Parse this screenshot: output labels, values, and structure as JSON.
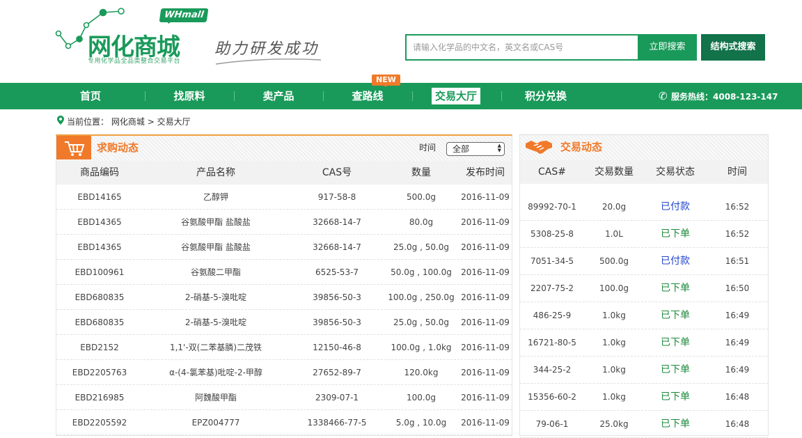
{
  "brand": {
    "logo_text": "网化商城",
    "logo_badge": "WHmall",
    "logo_sub": "专用化学品全品类整合交易平台",
    "slogan": "助力研发成功"
  },
  "search": {
    "placeholder": "请输入化学品的中文名，英文名或CAS号",
    "search_label": "立即搜索",
    "structure_label": "结构式搜索"
  },
  "nav": {
    "items": [
      "首页",
      "找原料",
      "卖产品",
      "查路线",
      "交易大厅",
      "积分兑换"
    ],
    "new_badge": "NEW",
    "hotline": "服务热线：4008-123-147"
  },
  "breadcrumb": {
    "prefix": "当前位置：",
    "home": "网化商城",
    "sep": ">",
    "current": "交易大厅"
  },
  "purchase": {
    "title": "求购动态",
    "time_label": "时间",
    "time_select": "全部",
    "headers": [
      "商品编码",
      "产品名称",
      "CAS号",
      "数量",
      "发布时间"
    ],
    "rows": [
      [
        "EBD14165",
        "乙醇钾",
        "917-58-8",
        "500.0g",
        "2016-11-09"
      ],
      [
        "EBD14365",
        "谷氨酸甲酯 盐酸盐",
        "32668-14-7",
        "80.0g",
        "2016-11-09"
      ],
      [
        "EBD14365",
        "谷氨酸甲酯 盐酸盐",
        "32668-14-7",
        "25.0g , 50.0g",
        "2016-11-09"
      ],
      [
        "EBD100961",
        "谷氨酸二甲酯",
        "6525-53-7",
        "50.0g , 100.0g",
        "2016-11-09"
      ],
      [
        "EBD680835",
        "2-硝基-5-溴吡啶",
        "39856-50-3",
        "100.0g , 250.0g",
        "2016-11-09"
      ],
      [
        "EBD680835",
        "2-硝基-5-溴吡啶",
        "39856-50-3",
        "25.0g , 50.0g",
        "2016-11-09"
      ],
      [
        "EBD2152",
        "1,1'-双(二苯基膦)二茂铁",
        "12150-46-8",
        "100.0g , 1.0kg",
        "2016-11-09"
      ],
      [
        "EBD2205763",
        "α-(4-氯苯基)吡啶-2-甲醇",
        "27652-89-7",
        "120.0kg",
        "2016-11-09"
      ],
      [
        "EBD216985",
        "阿魏酸甲酯",
        "2309-07-1",
        "100.0g",
        "2016-11-09"
      ],
      [
        "EBD2205592",
        "EPZ004777",
        "1338466-77-5",
        "5.0g , 10.0g",
        "2016-11-09"
      ]
    ]
  },
  "trade": {
    "title": "交易动态",
    "headers": [
      "CAS#",
      "交易数量",
      "交易状态",
      "时间"
    ],
    "rows": [
      [
        "89992-70-1",
        "20.0g",
        "已付款",
        "16:52"
      ],
      [
        "5308-25-8",
        "1.0L",
        "已下单",
        "16:52"
      ],
      [
        "7051-34-5",
        "500.0g",
        "已付款",
        "16:51"
      ],
      [
        "2207-75-2",
        "100.0g",
        "已下单",
        "16:50"
      ],
      [
        "486-25-9",
        "1.0kg",
        "已下单",
        "16:49"
      ],
      [
        "16721-80-5",
        "1.0kg",
        "已下单",
        "16:49"
      ],
      [
        "344-25-2",
        "1.0kg",
        "已下单",
        "16:49"
      ],
      [
        "15356-60-2",
        "1.0kg",
        "已下单",
        "16:48"
      ],
      [
        "79-06-1",
        "25.0kg",
        "已下单",
        "16:48"
      ]
    ],
    "status_colors": {
      "已付款": "#2244cc",
      "已下单": "#1a8a3a"
    }
  },
  "colors": {
    "brand_green": "#1a9a5a",
    "accent_orange": "#f07a2a"
  }
}
